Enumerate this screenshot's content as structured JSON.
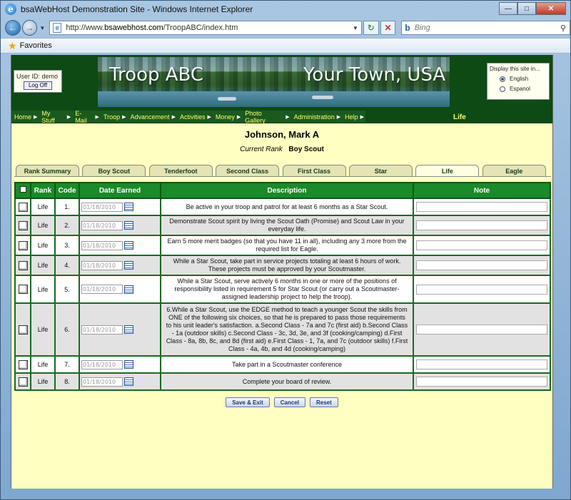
{
  "browser": {
    "title": "bsaWebHost Demonstration Site - Windows Internet Explorer",
    "url_prefix": "http://www.",
    "url_domain": "bsawebhost.com",
    "url_path": "/TroopABC/index.htm",
    "search_placeholder": "Bing",
    "search_engine": "b",
    "favorites_label": "Favorites"
  },
  "header": {
    "user_id_label": "User ID: demo",
    "logoff_label": "Log Off",
    "banner_left": "Troop ABC",
    "banner_right": "Your Town, USA",
    "language_title": "Display this site in...",
    "lang_english": "English",
    "lang_spanish": "Espanol"
  },
  "menu": {
    "items": [
      "Home",
      "My Stuff",
      "E-Mail",
      "Troop",
      "Advancement",
      "Activities",
      "Money",
      "Photo Gallery",
      "Administration",
      "Help"
    ],
    "current": "Life"
  },
  "scout": {
    "name": "Johnson, Mark A",
    "current_rank_label": "Current Rank",
    "current_rank_value": "Boy Scout"
  },
  "tabs": [
    "Rank Summary",
    "Boy Scout",
    "Tenderfoot",
    "Second Class",
    "First Class",
    "Star",
    "Life",
    "Eagle"
  ],
  "table": {
    "headers": {
      "rank": "Rank",
      "code": "Code",
      "date": "Date Earned",
      "desc": "Description",
      "note": "Note"
    },
    "rows": [
      {
        "rank": "Life",
        "code": "1.",
        "date": "01/18/2010",
        "desc": "Be active in your troop and patrol for at least 6 months as a Star Scout."
      },
      {
        "rank": "Life",
        "code": "2.",
        "date": "01/18/2010",
        "desc": "Demonstrate Scout spirit by living the Scout Oath (Promise) and Scout Law in your everyday life."
      },
      {
        "rank": "Life",
        "code": "3.",
        "date": "01/18/2010",
        "desc": "Earn 5 more merit badges (so that you have 11 in all), including any 3 more from the required list for Eagle."
      },
      {
        "rank": "Life",
        "code": "4.",
        "date": "01/18/2010",
        "desc": "While a Star Scout, take part in service projects totaling at least 6 hours of work. These projects must be approved by your Scoutmaster."
      },
      {
        "rank": "Life",
        "code": "5.",
        "date": "01/18/2010",
        "desc": "While a Star Scout, serve actively 6 months in one or more of the positions of responsibility listed in requirement 5 for Star Scout (or carry out a Scoutmaster-assigned leadership project to help the troop)."
      },
      {
        "rank": "Life",
        "code": "6.",
        "date": "01/18/2010",
        "desc": "6.While a Star Scout, use the EDGE method to teach a younger Scout the skills from ONE of the following six choices, so that he is prepared to pass those requirements to his unit leader's satisfaction. a.Second Class - 7a and 7c (first aid) b.Second Class - 1a (outdoor skills) c.Second Class - 3c, 3d, 3e, and 3f (cooking/camping) d.First Class - 8a, 8b, 8c, and 8d (first aid) e.First Class - 1, 7a, and 7c (outdoor skills) f.First Class - 4a, 4b, and 4d (cooking/camping)"
      },
      {
        "rank": "Life",
        "code": "7.",
        "date": "01/18/2010",
        "desc": "Take part in a Scoutmaster conference"
      },
      {
        "rank": "Life",
        "code": "8.",
        "date": "01/18/2010",
        "desc": "Complete your board of review."
      }
    ]
  },
  "actions": {
    "save": "Save & Exit",
    "cancel": "Cancel",
    "reset": "Reset"
  },
  "colors": {
    "page_bg": "#ffffc2",
    "header_green": "#0d4a14",
    "table_header": "#1a8a2a",
    "menu_text": "#ffff66"
  }
}
